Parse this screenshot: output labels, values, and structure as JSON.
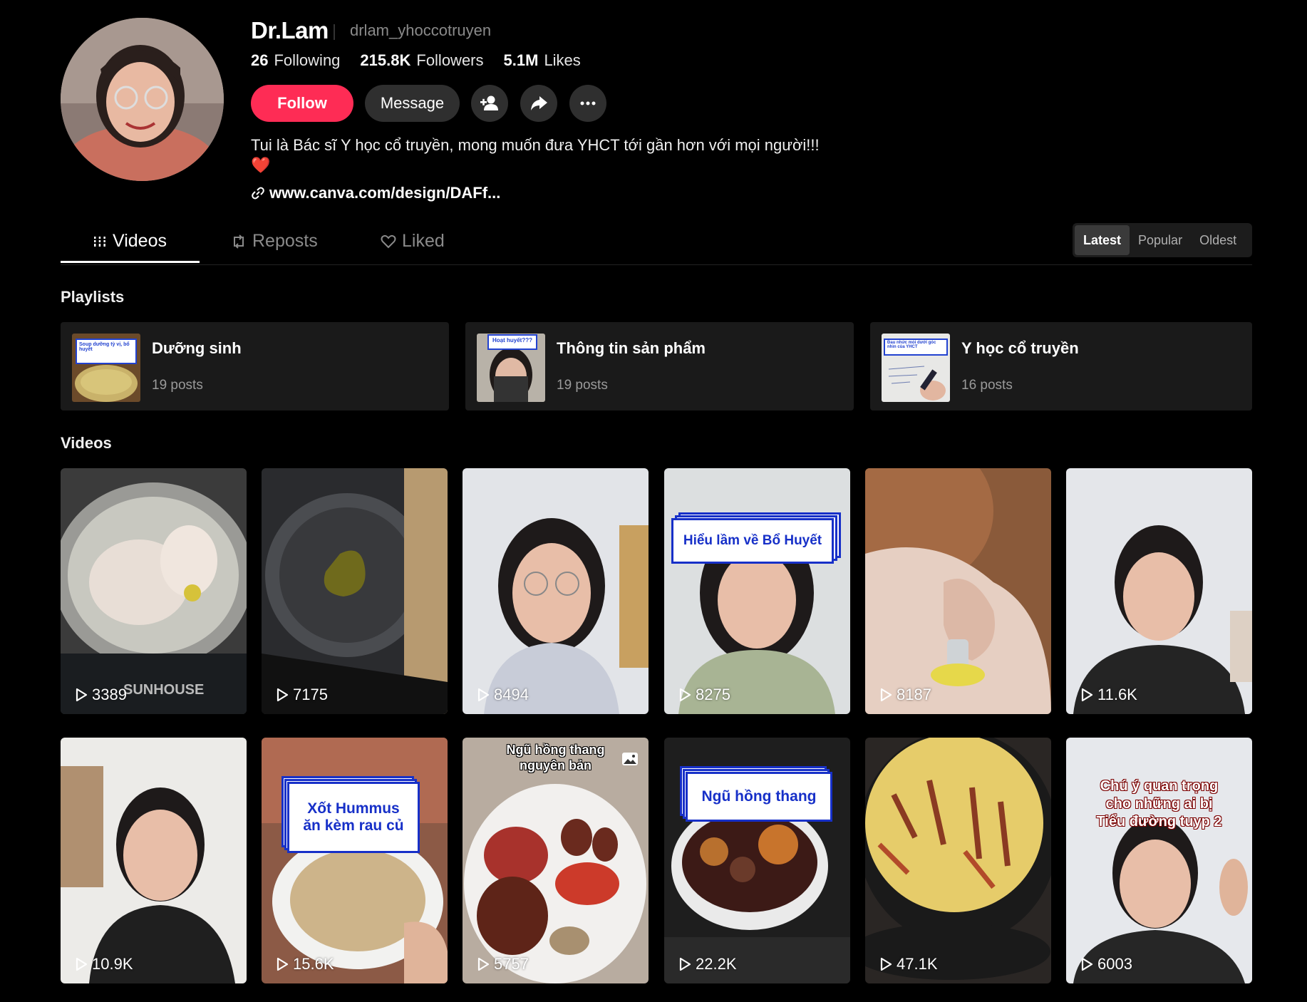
{
  "profile": {
    "name": "Dr.Lam",
    "handle": "drlam_yhoccotruyen",
    "following_count": "26",
    "following_label": "Following",
    "followers_count": "215.8K",
    "followers_label": "Followers",
    "likes_count": "5.1M",
    "likes_label": "Likes",
    "bio": "Tui là Bác sĩ Y học cổ truyền, mong muốn đưa YHCT tới gần hơn với mọi người!!!",
    "bio_emoji": "❤️",
    "link": "www.canva.com/design/DAFf..."
  },
  "actions": {
    "follow": "Follow",
    "message": "Message",
    "add_friend_icon": "add-user-icon",
    "share_icon": "share-icon",
    "more_icon": "more-icon"
  },
  "tabs": [
    {
      "label": "Videos",
      "active": true
    },
    {
      "label": "Reposts",
      "active": false
    },
    {
      "label": "Liked",
      "active": false
    }
  ],
  "sort": [
    {
      "label": "Latest",
      "active": true
    },
    {
      "label": "Popular",
      "active": false
    },
    {
      "label": "Oldest",
      "active": false
    }
  ],
  "playlists_title": "Playlists",
  "playlists": [
    {
      "title": "Dưỡng sinh",
      "count": "19 posts",
      "thumb_text": "Soup dưỡng tỳ vị, bổ huyết"
    },
    {
      "title": "Thông tin sản phẩm",
      "count": "19 posts",
      "thumb_text": "Hoạt huyết???"
    },
    {
      "title": "Y học cổ truyền",
      "count": "16 posts",
      "thumb_text": "Đau nhức mỏi dưới góc nhìn của YHCT"
    }
  ],
  "videos_title": "Videos",
  "videos": [
    {
      "views": "3389",
      "watermark": "SUNHOUSE"
    },
    {
      "views": "7175"
    },
    {
      "views": "8494"
    },
    {
      "views": "8275",
      "caption": "Hiểu lầm về Bổ Huyết"
    },
    {
      "views": "8187"
    },
    {
      "views": "11.6K"
    },
    {
      "views": "10.9K"
    },
    {
      "views": "15.6K",
      "caption_line1": "Xốt Hummus",
      "caption_line2": "ăn kèm rau củ"
    },
    {
      "views": "5757",
      "caption_line1": "Ngũ hồng thang",
      "caption_line2": "nguyên bản"
    },
    {
      "views": "22.2K",
      "caption": "Ngũ hồng thang"
    },
    {
      "views": "47.1K"
    },
    {
      "views": "6003",
      "caption_line1": "Chú ý quan trọng",
      "caption_line2": "cho những ai bị",
      "caption_line3": "Tiểu đường tuyp 2"
    }
  ]
}
